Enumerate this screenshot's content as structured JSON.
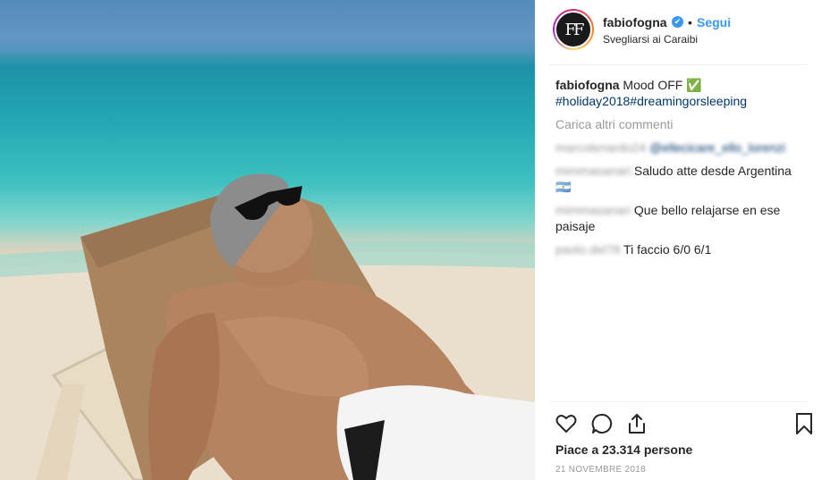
{
  "post": {
    "username": "fabiofogna",
    "verified_mark": "✔",
    "dot": "•",
    "follow_label": "Segui",
    "location": "Svegliarsi ai Caraibi",
    "avatar_initials": "FF"
  },
  "caption": {
    "username": "fabiofogna",
    "text": " Mood OFF ✅",
    "hashtags": "#holiday2018#dreamingorsleeping"
  },
  "load_more_label": "Carica altri commenti",
  "comments": [
    {
      "user": "marcolenardo24",
      "text": "@ellecicare_ello_lorenzi"
    },
    {
      "user": "mimmasanari",
      "text": " Saludo atte desde Argentina 🇦🇷"
    },
    {
      "user": "mimmasanari",
      "text": " Que bello relajarse en ese paisaje"
    },
    {
      "user": "paolo.del78",
      "text": " Ti faccio 6/0 6/1"
    }
  ],
  "likes_text": "Piace a 23.314 persone",
  "date_text": "21 NOVEMBRE 2018",
  "icons": [
    "heart-icon",
    "comment-icon",
    "share-icon",
    "bookmark-icon"
  ],
  "colors": {
    "link": "#3897f0",
    "hashtag": "#003569",
    "muted": "#999999"
  }
}
